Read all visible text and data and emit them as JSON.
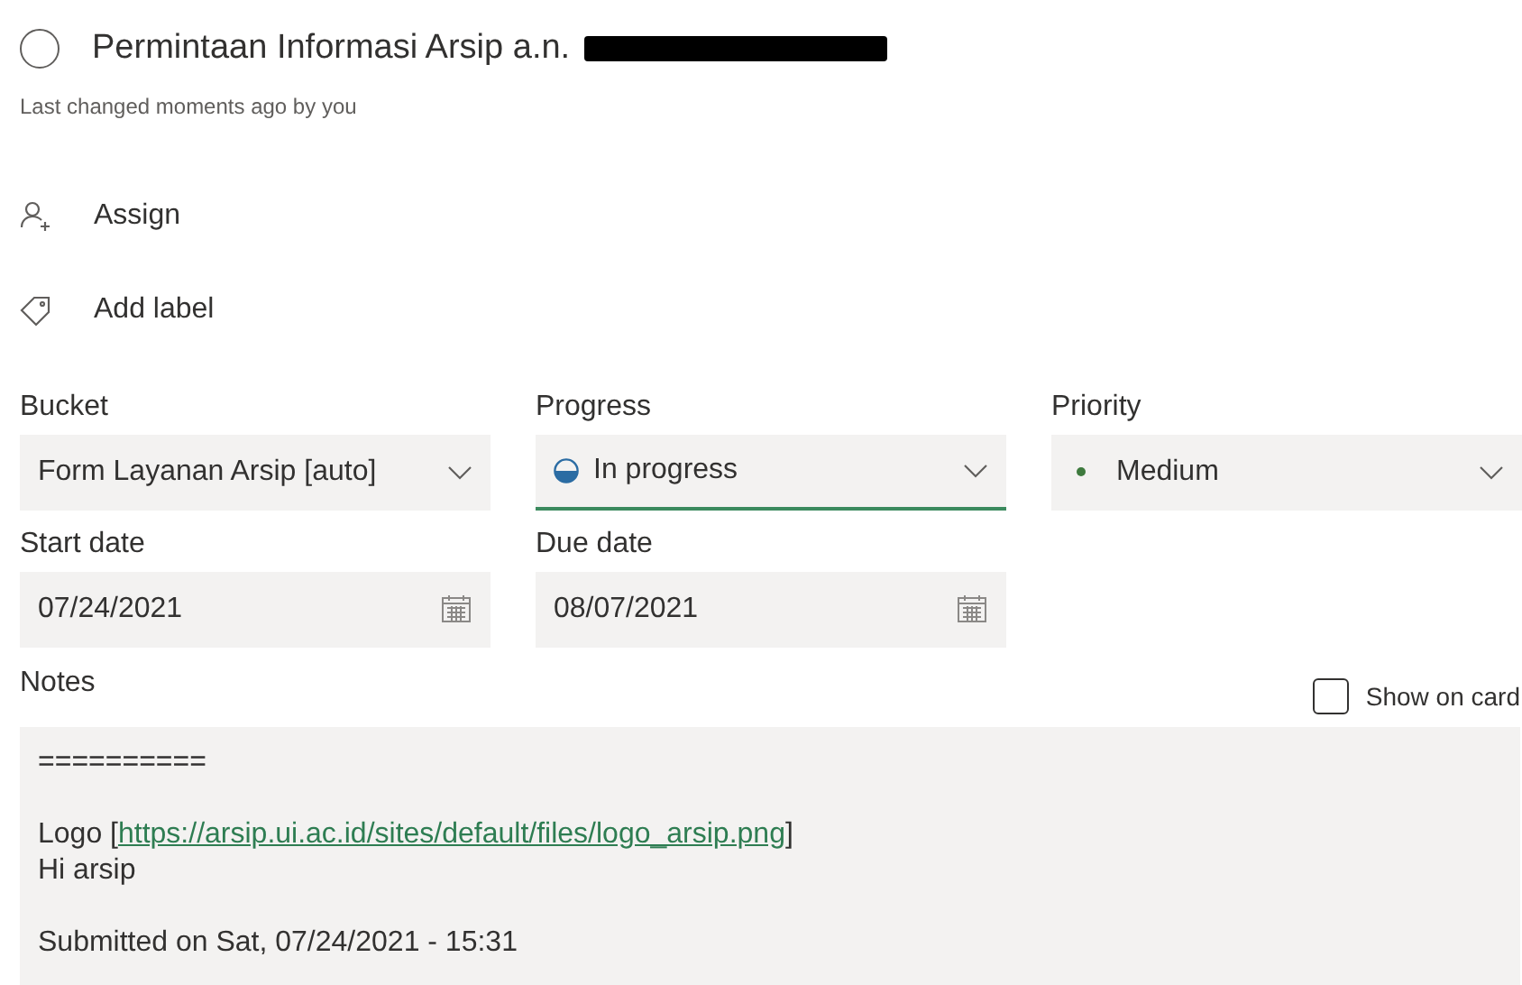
{
  "task": {
    "title": "Permintaan Informasi Arsip a.n.",
    "completed": false,
    "redacted_name": true,
    "last_changed": "Last changed moments ago by you"
  },
  "actions": [
    {
      "kind": "assign",
      "label": "Assign"
    },
    {
      "kind": "label",
      "label": "Add label"
    }
  ],
  "fields": [
    {
      "label": "Bucket",
      "kind": "select",
      "value": "Form Layanan Arsip [auto]",
      "focused": false
    },
    {
      "label": "Progress",
      "kind": "progress",
      "value": "In progress",
      "focused": true
    },
    {
      "label": "Priority",
      "kind": "priority",
      "value": "Medium",
      "focused": false,
      "color": "#3e7a3e"
    },
    {
      "label": "Start date",
      "kind": "date",
      "value": "07/24/2021",
      "focused": false
    },
    {
      "label": "Due date",
      "kind": "date",
      "value": "08/07/2021",
      "focused": false
    }
  ],
  "notes": {
    "label": "Notes",
    "show_on_card": {
      "label": "Show on card",
      "checked": false
    },
    "paragraphs": [
      {
        "lines": [
          {
            "kind": "text",
            "text": "=========="
          }
        ]
      },
      {
        "lines": [
          {
            "kind": "link",
            "before": "Logo [",
            "link": "https://arsip.ui.ac.id/sites/default/files/logo_arsip.png",
            "after": "]"
          },
          {
            "kind": "text",
            "text": "Hi arsip"
          }
        ]
      },
      {
        "lines": [
          {
            "kind": "text",
            "text": "Submitted on Sat, 07/24/2021 - 15:31"
          }
        ]
      }
    ]
  }
}
